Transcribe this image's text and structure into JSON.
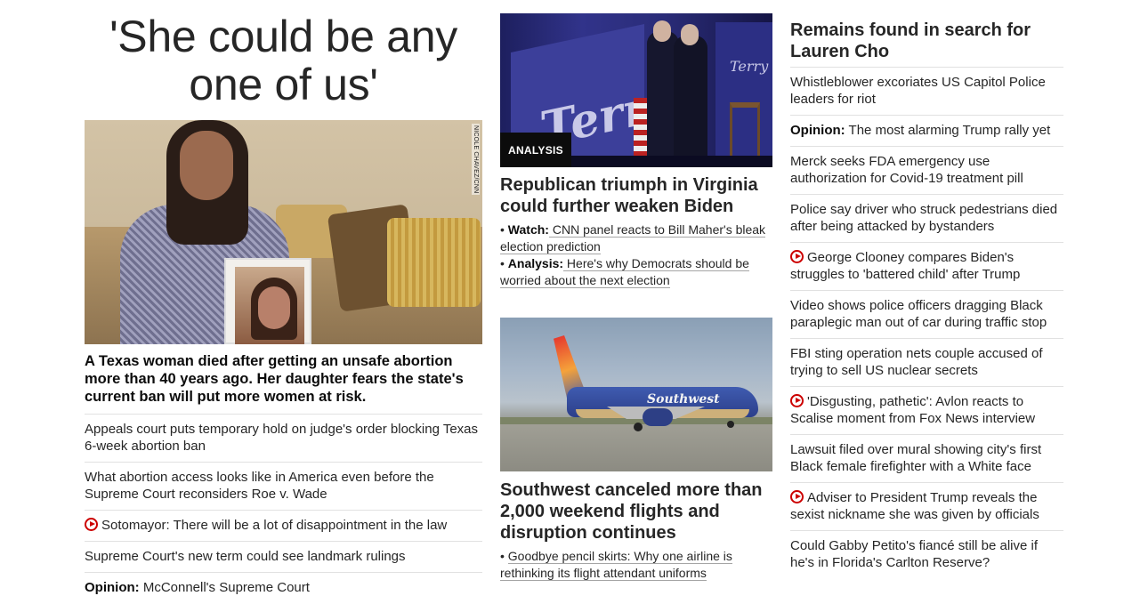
{
  "column1": {
    "big_headline": "'She could be any one of us'",
    "photo_credit": "NICOLE CHAVEZ/CNN",
    "lead_title": "A Texas woman died after getting an unsafe abortion more than 40 years ago. Her daughter fears the state's current ban will put more women at risk.",
    "items": [
      {
        "prefix": "",
        "text": "Appeals court puts temporary hold on judge's order blocking Texas 6-week abortion ban",
        "video": false
      },
      {
        "prefix": "",
        "text": "What abortion access looks like in America even before the Supreme Court reconsiders Roe v. Wade",
        "video": false
      },
      {
        "prefix": "",
        "text": "Sotomayor: There will be a lot of disappointment in the law",
        "video": true
      },
      {
        "prefix": "",
        "text": "Supreme Court's new term could see landmark rulings",
        "video": false
      },
      {
        "prefix": "Opinion:",
        "text": " McConnell's Supreme Court",
        "video": false
      }
    ]
  },
  "column2": {
    "story1": {
      "badge": "ANALYSIS",
      "sign_text": "Terry",
      "title": "Republican triumph in Virginia could further weaken Biden",
      "sublinks": [
        {
          "prefix": "Watch:",
          "text": " CNN panel reacts to Bill Maher's bleak election prediction"
        },
        {
          "prefix": "Analysis:",
          "text": " Here's why Democrats should be worried about the next election"
        }
      ]
    },
    "story2": {
      "plane_logo": "Southwest",
      "title": "Southwest canceled more than 2,000 weekend flights and disruption continues",
      "sublinks": [
        {
          "prefix": "",
          "text": "Goodbye pencil skirts: Why one airline is rethinking its flight attendant uniforms"
        }
      ]
    }
  },
  "column3": {
    "top_headline": "Remains found in search for Lauren Cho",
    "items": [
      {
        "prefix": "",
        "text": "Whistleblower excoriates US Capitol Police leaders for riot",
        "video": false
      },
      {
        "prefix": "Opinion:",
        "text": " The most alarming Trump rally yet",
        "video": false
      },
      {
        "prefix": "",
        "text": "Merck seeks FDA emergency use authorization for Covid-19 treatment pill",
        "video": false
      },
      {
        "prefix": "",
        "text": "Police say driver who struck pedestrians died after being attacked by bystanders",
        "video": false
      },
      {
        "prefix": "",
        "text": "George Clooney compares Biden's struggles to 'battered child' after Trump",
        "video": true
      },
      {
        "prefix": "",
        "text": "Video shows police officers dragging Black paraplegic man out of car during traffic stop",
        "video": false
      },
      {
        "prefix": "",
        "text": "FBI sting operation nets couple accused of trying to sell US nuclear secrets",
        "video": false
      },
      {
        "prefix": "",
        "text": "'Disgusting, pathetic': Avlon reacts to Scalise moment from Fox News interview",
        "video": true
      },
      {
        "prefix": "",
        "text": "Lawsuit filed over mural showing city's first Black female firefighter with a White face",
        "video": false
      },
      {
        "prefix": "",
        "text": "Adviser to President Trump reveals the sexist nickname she was given by officials",
        "video": true
      },
      {
        "prefix": "",
        "text": "Could Gabby Petito's fiancé still be alive if he's in Florida's Carlton Reserve?",
        "video": false
      }
    ]
  },
  "colors": {
    "text": "#262626",
    "accent_red": "#cc0000",
    "divider": "#e1e1e1"
  }
}
